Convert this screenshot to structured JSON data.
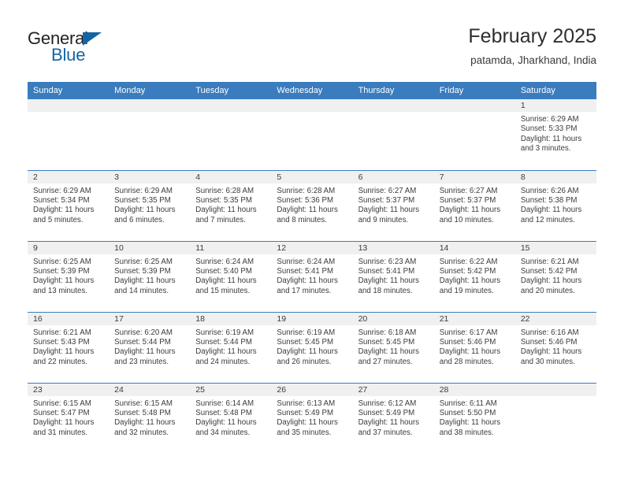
{
  "brand": {
    "name_part1": "General",
    "name_part2": "Blue",
    "logo_icon": "blue-triangle-mark",
    "accent_color": "#1464a5"
  },
  "header": {
    "title": "February 2025",
    "location": "patamda, Jharkhand, India"
  },
  "theme": {
    "header_band_color": "#3a7cbe",
    "daynum_band_color": "#f0f0f0",
    "row_divider_color": "#3a7cbe",
    "text_color": "#3c3c3c"
  },
  "weekdays": [
    "Sunday",
    "Monday",
    "Tuesday",
    "Wednesday",
    "Thursday",
    "Friday",
    "Saturday"
  ],
  "labels": {
    "sunrise": "Sunrise:",
    "sunset": "Sunset:",
    "daylight": "Daylight:"
  },
  "weeks": [
    [
      {
        "empty": true
      },
      {
        "empty": true
      },
      {
        "empty": true
      },
      {
        "empty": true
      },
      {
        "empty": true
      },
      {
        "empty": true
      },
      {
        "day": "1",
        "sunrise": "Sunrise: 6:29 AM",
        "sunset": "Sunset: 5:33 PM",
        "daylight": "Daylight: 11 hours and 3 minutes."
      }
    ],
    [
      {
        "day": "2",
        "sunrise": "Sunrise: 6:29 AM",
        "sunset": "Sunset: 5:34 PM",
        "daylight": "Daylight: 11 hours and 5 minutes."
      },
      {
        "day": "3",
        "sunrise": "Sunrise: 6:29 AM",
        "sunset": "Sunset: 5:35 PM",
        "daylight": "Daylight: 11 hours and 6 minutes."
      },
      {
        "day": "4",
        "sunrise": "Sunrise: 6:28 AM",
        "sunset": "Sunset: 5:35 PM",
        "daylight": "Daylight: 11 hours and 7 minutes."
      },
      {
        "day": "5",
        "sunrise": "Sunrise: 6:28 AM",
        "sunset": "Sunset: 5:36 PM",
        "daylight": "Daylight: 11 hours and 8 minutes."
      },
      {
        "day": "6",
        "sunrise": "Sunrise: 6:27 AM",
        "sunset": "Sunset: 5:37 PM",
        "daylight": "Daylight: 11 hours and 9 minutes."
      },
      {
        "day": "7",
        "sunrise": "Sunrise: 6:27 AM",
        "sunset": "Sunset: 5:37 PM",
        "daylight": "Daylight: 11 hours and 10 minutes."
      },
      {
        "day": "8",
        "sunrise": "Sunrise: 6:26 AM",
        "sunset": "Sunset: 5:38 PM",
        "daylight": "Daylight: 11 hours and 12 minutes."
      }
    ],
    [
      {
        "day": "9",
        "sunrise": "Sunrise: 6:25 AM",
        "sunset": "Sunset: 5:39 PM",
        "daylight": "Daylight: 11 hours and 13 minutes."
      },
      {
        "day": "10",
        "sunrise": "Sunrise: 6:25 AM",
        "sunset": "Sunset: 5:39 PM",
        "daylight": "Daylight: 11 hours and 14 minutes."
      },
      {
        "day": "11",
        "sunrise": "Sunrise: 6:24 AM",
        "sunset": "Sunset: 5:40 PM",
        "daylight": "Daylight: 11 hours and 15 minutes."
      },
      {
        "day": "12",
        "sunrise": "Sunrise: 6:24 AM",
        "sunset": "Sunset: 5:41 PM",
        "daylight": "Daylight: 11 hours and 17 minutes."
      },
      {
        "day": "13",
        "sunrise": "Sunrise: 6:23 AM",
        "sunset": "Sunset: 5:41 PM",
        "daylight": "Daylight: 11 hours and 18 minutes."
      },
      {
        "day": "14",
        "sunrise": "Sunrise: 6:22 AM",
        "sunset": "Sunset: 5:42 PM",
        "daylight": "Daylight: 11 hours and 19 minutes."
      },
      {
        "day": "15",
        "sunrise": "Sunrise: 6:21 AM",
        "sunset": "Sunset: 5:42 PM",
        "daylight": "Daylight: 11 hours and 20 minutes."
      }
    ],
    [
      {
        "day": "16",
        "sunrise": "Sunrise: 6:21 AM",
        "sunset": "Sunset: 5:43 PM",
        "daylight": "Daylight: 11 hours and 22 minutes."
      },
      {
        "day": "17",
        "sunrise": "Sunrise: 6:20 AM",
        "sunset": "Sunset: 5:44 PM",
        "daylight": "Daylight: 11 hours and 23 minutes."
      },
      {
        "day": "18",
        "sunrise": "Sunrise: 6:19 AM",
        "sunset": "Sunset: 5:44 PM",
        "daylight": "Daylight: 11 hours and 24 minutes."
      },
      {
        "day": "19",
        "sunrise": "Sunrise: 6:19 AM",
        "sunset": "Sunset: 5:45 PM",
        "daylight": "Daylight: 11 hours and 26 minutes."
      },
      {
        "day": "20",
        "sunrise": "Sunrise: 6:18 AM",
        "sunset": "Sunset: 5:45 PM",
        "daylight": "Daylight: 11 hours and 27 minutes."
      },
      {
        "day": "21",
        "sunrise": "Sunrise: 6:17 AM",
        "sunset": "Sunset: 5:46 PM",
        "daylight": "Daylight: 11 hours and 28 minutes."
      },
      {
        "day": "22",
        "sunrise": "Sunrise: 6:16 AM",
        "sunset": "Sunset: 5:46 PM",
        "daylight": "Daylight: 11 hours and 30 minutes."
      }
    ],
    [
      {
        "day": "23",
        "sunrise": "Sunrise: 6:15 AM",
        "sunset": "Sunset: 5:47 PM",
        "daylight": "Daylight: 11 hours and 31 minutes."
      },
      {
        "day": "24",
        "sunrise": "Sunrise: 6:15 AM",
        "sunset": "Sunset: 5:48 PM",
        "daylight": "Daylight: 11 hours and 32 minutes."
      },
      {
        "day": "25",
        "sunrise": "Sunrise: 6:14 AM",
        "sunset": "Sunset: 5:48 PM",
        "daylight": "Daylight: 11 hours and 34 minutes."
      },
      {
        "day": "26",
        "sunrise": "Sunrise: 6:13 AM",
        "sunset": "Sunset: 5:49 PM",
        "daylight": "Daylight: 11 hours and 35 minutes."
      },
      {
        "day": "27",
        "sunrise": "Sunrise: 6:12 AM",
        "sunset": "Sunset: 5:49 PM",
        "daylight": "Daylight: 11 hours and 37 minutes."
      },
      {
        "day": "28",
        "sunrise": "Sunrise: 6:11 AM",
        "sunset": "Sunset: 5:50 PM",
        "daylight": "Daylight: 11 hours and 38 minutes."
      },
      {
        "empty": true
      }
    ]
  ]
}
